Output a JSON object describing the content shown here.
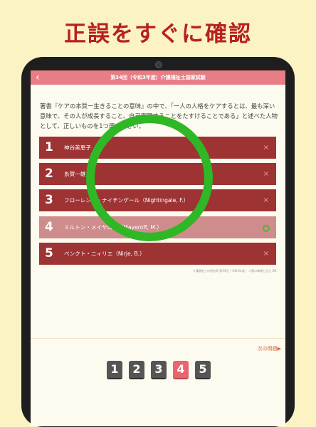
{
  "promo": {
    "title": "正誤をすぐに確認"
  },
  "navbar": {
    "title": "第34回（令和3年度）介護福祉士国家試験",
    "back_icon": "chevron-left-icon"
  },
  "question": {
    "text": "著書『ケアの本質ー生きることの意味』の中で、「一人の人格をケアするとは、最も深い意味で、その人が成長すること、自己実現することをたすけることである」と述べた人物として、正しいものを1つ選びなさい。"
  },
  "answers": [
    {
      "num": "1",
      "text": "神谷美恵子",
      "mark": "×",
      "correct": false
    },
    {
      "num": "2",
      "text": "糸賀一雄",
      "mark": "×",
      "correct": false
    },
    {
      "num": "3",
      "text": "フローレンス・ナイチンゲール（Nightingale, F.）",
      "mark": "×",
      "correct": false
    },
    {
      "num": "4",
      "text": "ミルトン・メイヤロフ（Mayeroff, M.）",
      "mark": "○",
      "correct": true
    },
    {
      "num": "5",
      "text": "ベンクト・ニィリエ（Nirje, B.）",
      "mark": "×",
      "correct": false
    }
  ],
  "source": "介護福祉士の過去問 第34回（令和3年度） 人間の尊厳と自立 問1",
  "next": {
    "label": "次の問題▶"
  },
  "pager": {
    "pages": [
      "1",
      "2",
      "3",
      "4",
      "5"
    ],
    "current": "4"
  },
  "colors": {
    "accent": "#e77e86",
    "answer_wrong": "#9e3334",
    "answer_correct": "#cf8c8c",
    "ring": "#2fb726",
    "title": "#b8201f"
  }
}
